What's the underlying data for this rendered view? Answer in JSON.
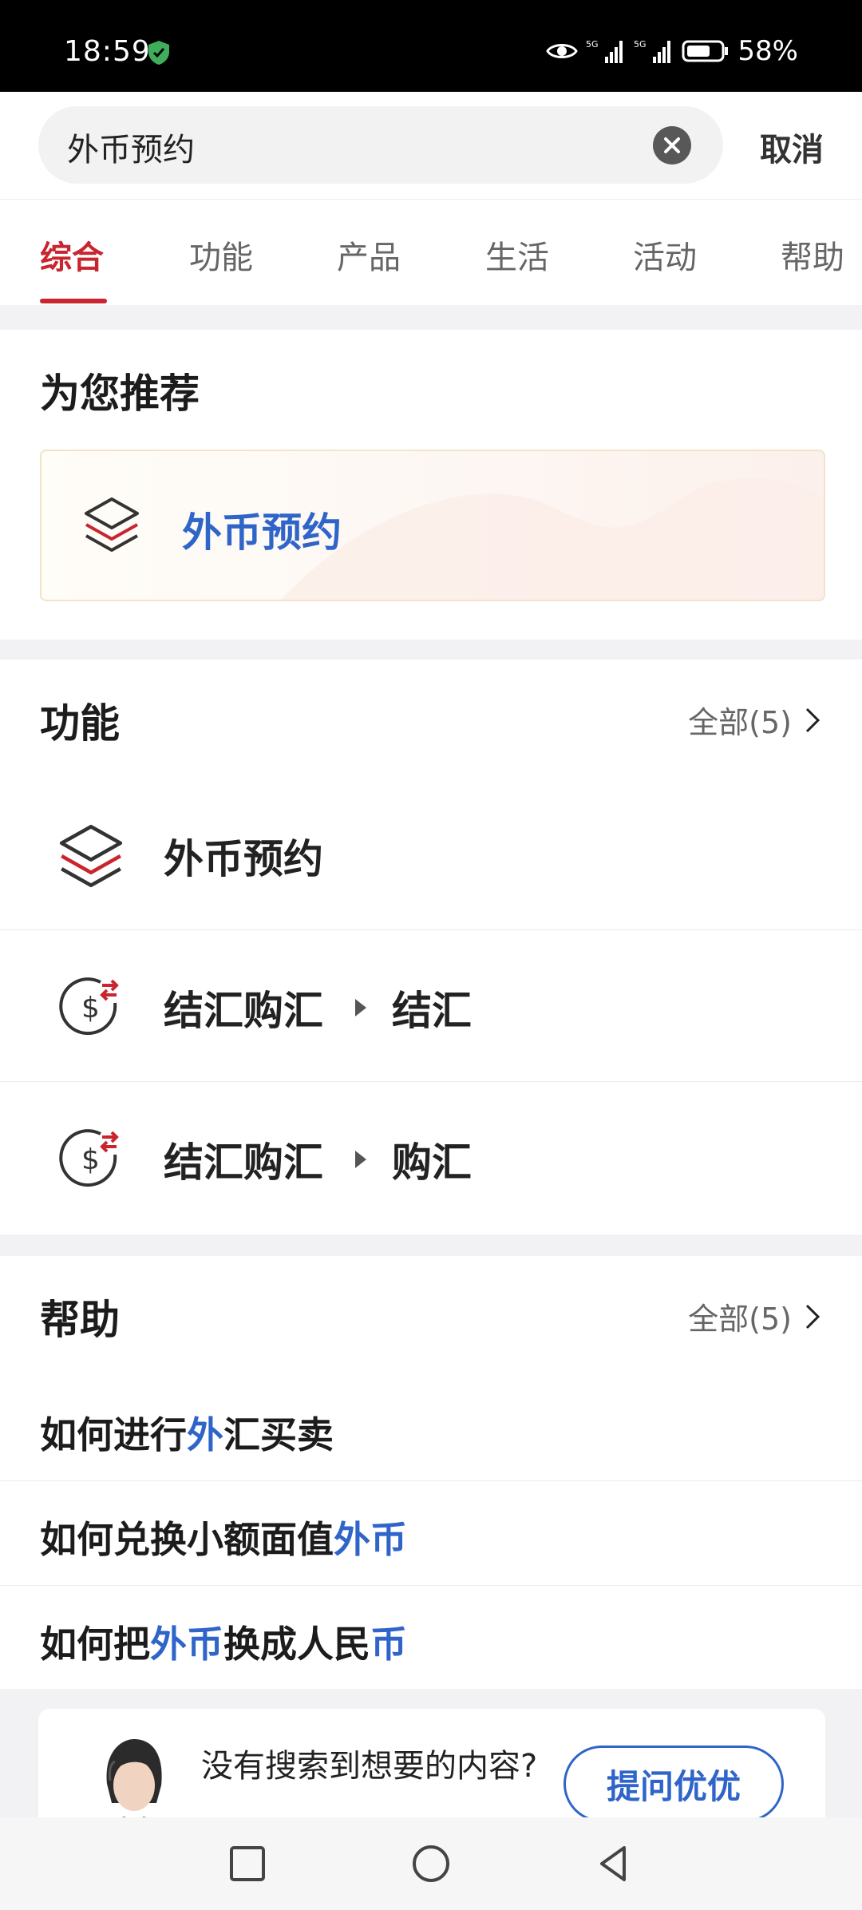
{
  "status_bar": {
    "time": "18:59",
    "network_1": "5G",
    "network_2": "5G",
    "battery": "58%",
    "icons": [
      "shield-check-icon",
      "eye-icon",
      "signal-icon",
      "battery-icon"
    ]
  },
  "search": {
    "query": "外币预约",
    "clear_icon": "clear-icon",
    "cancel_label": "取消"
  },
  "tabs": [
    {
      "label": "综合",
      "active": true
    },
    {
      "label": "功能"
    },
    {
      "label": "产品"
    },
    {
      "label": "生活"
    },
    {
      "label": "活动"
    },
    {
      "label": "帮助"
    }
  ],
  "recommend": {
    "title": "为您推荐",
    "card_label": "外币预约",
    "card_icon": "layers-icon"
  },
  "functions": {
    "title": "功能",
    "see_all": "全部(5)",
    "items": [
      {
        "icon": "layers-icon",
        "label": "外币预约"
      },
      {
        "icon": "currency-exchange-icon",
        "parent": "结汇购汇",
        "child": "结汇"
      },
      {
        "icon": "currency-exchange-icon",
        "parent": "结汇购汇",
        "child": "购汇"
      }
    ]
  },
  "help": {
    "title": "帮助",
    "see_all": "全部(5)",
    "items": [
      {
        "pre": "如何进行",
        "hl": "外",
        "post": "汇买卖"
      },
      {
        "pre": "如何兑换小额面值",
        "hl": "外币",
        "post": ""
      },
      {
        "pre": "如何把",
        "hl": "外币",
        "mid": "换成人民",
        "hl2": "币"
      }
    ]
  },
  "assistant": {
    "text": "没有搜索到想要的内容?",
    "button": "提问优优"
  },
  "nav": {
    "icons": [
      "recent-apps-icon",
      "home-icon",
      "back-icon"
    ]
  },
  "colors": {
    "accent_red": "#c9252f",
    "highlight_blue": "#2f64c9"
  }
}
